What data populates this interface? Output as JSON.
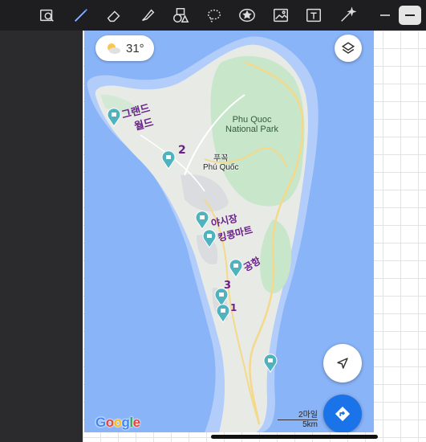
{
  "toolbar": {
    "tools": [
      "viewer-icon",
      "pen-icon",
      "eraser-icon",
      "highlighter-icon",
      "shapes-icon",
      "lasso-icon",
      "sticker-icon",
      "image-icon",
      "text-icon",
      "laser-pointer-icon"
    ],
    "active_tool": "pen-icon"
  },
  "map": {
    "weather": {
      "temperature": "31°"
    },
    "park_label_line1": "Phu Quoc",
    "park_label_line2": "National Park",
    "town_label_korean": "푸꼭",
    "town_label": "Phú Quốc",
    "attribution": "Google",
    "scale": {
      "line1": "2마일",
      "line2": "5km"
    }
  },
  "annotations": {
    "a1": "그랜드",
    "a2": "월드",
    "a3": "2",
    "a4": "야시장",
    "a5": "킹콩마트",
    "a6": "공항",
    "a7": "3",
    "a8": "1"
  },
  "colors": {
    "ocean": "#8ab4f8",
    "land": "#e8eae6",
    "park": "#c8e6c9",
    "pin": "#4fb3bf",
    "annotation": "#6a1f8a",
    "directions_fab": "#1a73e8"
  }
}
